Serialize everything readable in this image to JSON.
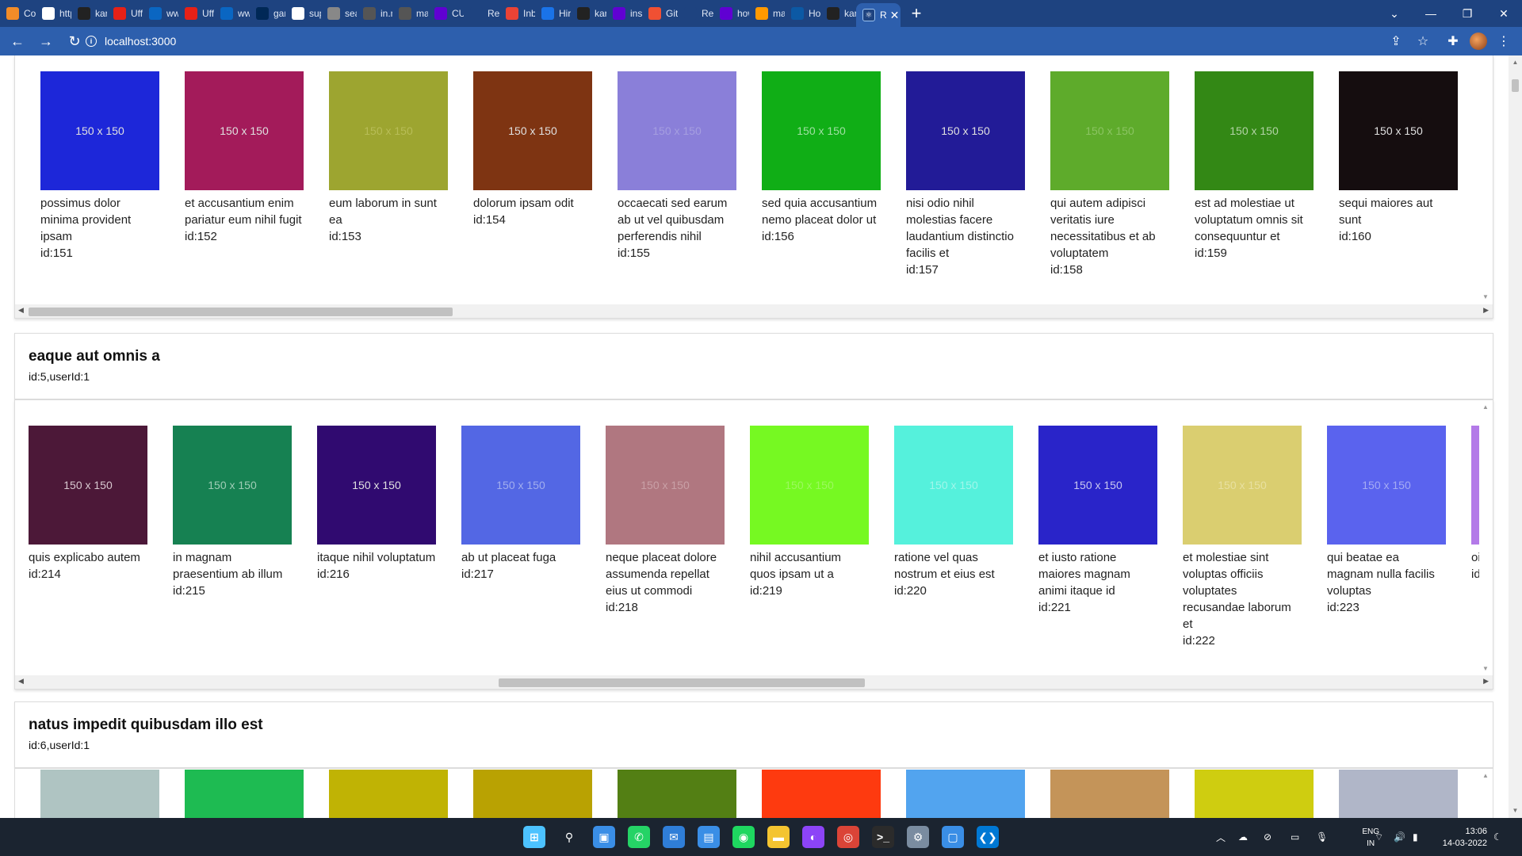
{
  "browser": {
    "tabs": [
      {
        "label": "Cons",
        "icon": "codepen-icon",
        "color": "#f28c28"
      },
      {
        "label": "http:",
        "icon": "globe-icon",
        "color": "#ffffff"
      },
      {
        "label": "karti",
        "icon": "github-icon",
        "color": "#222222"
      },
      {
        "label": "Uff T",
        "icon": "youtube-icon",
        "color": "#e62117"
      },
      {
        "label": "www",
        "icon": "linkedin-icon",
        "color": "#0a66c2"
      },
      {
        "label": "Uff T",
        "icon": "youtube-icon",
        "color": "#e62117"
      },
      {
        "label": "www",
        "icon": "linkedin-icon",
        "color": "#0a66c2"
      },
      {
        "label": "gartr",
        "icon": "gartner-icon",
        "color": "#002856"
      },
      {
        "label": "supp",
        "icon": "google-icon",
        "color": "#ffffff"
      },
      {
        "label": "searc",
        "icon": "yellow-icon",
        "color": "#888888"
      },
      {
        "label": "in.m",
        "icon": "m-icon",
        "color": "#555555"
      },
      {
        "label": "mail.",
        "icon": "gmail-icon",
        "color": "#555555"
      },
      {
        "label": "CUR",
        "icon": "yahoo-icon",
        "color": "#6001d2"
      },
      {
        "label": "Reac",
        "icon": "react-icon",
        "color": "#1e4380"
      },
      {
        "label": "Inbo",
        "icon": "gmail-icon",
        "color": "#ea4335"
      },
      {
        "label": "Hire",
        "icon": "hire-icon",
        "color": "#1a73e8"
      },
      {
        "label": "karti",
        "icon": "github-icon",
        "color": "#222222"
      },
      {
        "label": "insta",
        "icon": "yahoo-icon",
        "color": "#6001d2"
      },
      {
        "label": "Git -",
        "icon": "git-icon",
        "color": "#f05033"
      },
      {
        "label": "Reac",
        "icon": "react-icon",
        "color": "#1e4380"
      },
      {
        "label": "how",
        "icon": "yahoo-icon",
        "color": "#6001d2"
      },
      {
        "label": "mac",
        "icon": "amazon-icon",
        "color": "#ff9900"
      },
      {
        "label": "How",
        "icon": "edge-icon",
        "color": "#0c59a4"
      },
      {
        "label": "karti",
        "icon": "github-icon",
        "color": "#222222"
      }
    ],
    "active_tab": {
      "label": "R",
      "icon": "react-icon"
    },
    "new_tab_label": "+",
    "url": "localhost:3000",
    "window_controls": {
      "dropdown": "⌄",
      "minimize": "—",
      "restore": "❐",
      "close": "✕"
    }
  },
  "posts": [
    {
      "title": "",
      "meta": "",
      "photos": [
        {
          "color": "#1d27d9",
          "text_color": "#e0e0e0",
          "label": "150 x 150",
          "title": "possimus dolor minima provident ipsam",
          "id": "id:151"
        },
        {
          "color": "#a31b5a",
          "text_color": "#e0e0e0",
          "label": "150 x 150",
          "title": "et accusantium enim pariatur eum nihil fugit",
          "id": "id:152"
        },
        {
          "color": "#9da530",
          "text_color": "#b8bd57",
          "label": "150 x 150",
          "title": "eum laborum in sunt ea",
          "id": "id:153"
        },
        {
          "color": "#7e3412",
          "text_color": "#e0e0e0",
          "label": "150 x 150",
          "title": "dolorum ipsam odit",
          "id": "id:154"
        },
        {
          "color": "#8a7fd9",
          "text_color": "#a59ee0",
          "label": "150 x 150",
          "title": "occaecati sed earum ab ut vel quibusdam perferendis nihil",
          "id": "id:155"
        },
        {
          "color": "#10ae16",
          "text_color": "#9fe0a2",
          "label": "150 x 150",
          "title": "sed quia accusantium nemo placeat dolor ut",
          "id": "id:156"
        },
        {
          "color": "#221b97",
          "text_color": "#e0e0e0",
          "label": "150 x 150",
          "title": "nisi odio nihil molestias facere laudantium distinctio facilis et",
          "id": "id:157"
        },
        {
          "color": "#5eab2b",
          "text_color": "#8bc462",
          "label": "150 x 150",
          "title": "qui autem adipisci veritatis iure necessitatibus et ab voluptatem",
          "id": "id:158"
        },
        {
          "color": "#338815",
          "text_color": "#b3d3a6",
          "label": "150 x 150",
          "title": "est ad molestiae ut voluptatum omnis sit consequuntur et",
          "id": "id:159"
        },
        {
          "color": "#150d0f",
          "text_color": "#e0e0e0",
          "label": "150 x 150",
          "title": "sequi maiores aut sunt",
          "id": "id:160"
        }
      ]
    },
    {
      "title": "eaque aut omnis a",
      "meta": "id:5,userId:1",
      "photos": [
        {
          "color": "#4c1838",
          "text_color": "#d8c8d0",
          "label": "150 x 150",
          "title": "quis explicabo autem",
          "id": "id:214"
        },
        {
          "color": "#168152",
          "text_color": "#9fcdb6",
          "label": "150 x 150",
          "title": "in magnam praesentium ab illum",
          "id": "id:215"
        },
        {
          "color": "#300a70",
          "text_color": "#e0e0e0",
          "label": "150 x 150",
          "title": "itaque nihil voluptatum",
          "id": "id:216"
        },
        {
          "color": "#5367e4",
          "text_color": "#a2aeee",
          "label": "150 x 150",
          "title": "ab ut placeat fuga",
          "id": "id:217"
        },
        {
          "color": "#b07780",
          "text_color": "#c9a0a6",
          "label": "150 x 150",
          "title": "neque placeat dolore assumenda repellat eius ut commodi",
          "id": "id:218"
        },
        {
          "color": "#76f922",
          "text_color": "#9cf95f",
          "label": "150 x 150",
          "title": "nihil accusantium quos ipsam ut a",
          "id": "id:219"
        },
        {
          "color": "#55f1dc",
          "text_color": "#a0f6ea",
          "label": "150 x 150",
          "title": "ratione vel quas nostrum et eius est",
          "id": "id:220"
        },
        {
          "color": "#2924c9",
          "text_color": "#c8c7f0",
          "label": "150 x 150",
          "title": "et iusto ratione maiores magnam animi itaque id",
          "id": "id:221"
        },
        {
          "color": "#dace70",
          "text_color": "#e8e0a0",
          "label": "150 x 150",
          "title": "et molestiae sint voluptas officiis voluptates recusandae laborum et",
          "id": "id:222"
        },
        {
          "color": "#5a63ee",
          "text_color": "#a5abf4",
          "label": "150 x 150",
          "title": "qui beatae ea magnam nulla facilis voluptas",
          "id": "id:223"
        },
        {
          "color": "#b37ae8",
          "text_color": "#d9bff3",
          "label": "",
          "title": "oi ve te",
          "id": "id"
        }
      ]
    },
    {
      "title": "natus impedit quibusdam illo est",
      "meta": "id:6,userId:1",
      "photos": [
        {
          "color": "#afc4c2"
        },
        {
          "color": "#1ebb52"
        },
        {
          "color": "#c0b304"
        },
        {
          "color": "#b9a202"
        },
        {
          "color": "#537f14"
        },
        {
          "color": "#fe3a0f"
        },
        {
          "color": "#52a4ef"
        },
        {
          "color": "#c49459"
        },
        {
          "color": "#cfcd10"
        },
        {
          "color": "#b0b6c8"
        }
      ]
    }
  ],
  "taskbar": {
    "apps": [
      {
        "icon": "windows-start-icon",
        "color": "#4cc2ff"
      },
      {
        "icon": "search-icon",
        "color": "#1b2430"
      },
      {
        "icon": "task-view-icon",
        "color": "#3a8ee6"
      },
      {
        "icon": "whatsapp-icon",
        "color": "#25d366"
      },
      {
        "icon": "mail-icon",
        "color": "#2f7ed8"
      },
      {
        "icon": "store-icon",
        "color": "#3a8ee6"
      },
      {
        "icon": "spotify-icon",
        "color": "#1ed760"
      },
      {
        "icon": "file-explorer-icon",
        "color": "#f4c430"
      },
      {
        "icon": "podcast-icon",
        "color": "#8c44f7"
      },
      {
        "icon": "chrome-icon",
        "color": "#db4437"
      },
      {
        "icon": "terminal-icon",
        "color": "#2b2b2b"
      },
      {
        "icon": "settings-icon",
        "color": "#7a8ca0"
      },
      {
        "icon": "remote-desktop-icon",
        "color": "#3a8ee6"
      },
      {
        "icon": "vscode-icon",
        "color": "#0078d4"
      }
    ],
    "language": {
      "line1": "ENG",
      "line2": "IN"
    },
    "time": "13:06",
    "date": "14-03-2022"
  }
}
